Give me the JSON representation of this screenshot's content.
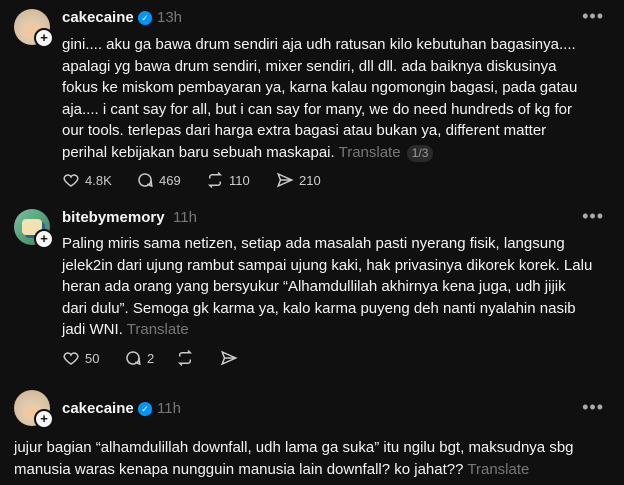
{
  "posts": [
    {
      "username": "cakecaine",
      "verified": true,
      "time": "13h",
      "lines": [
        "gini.... aku ga bawa drum sendiri aja udh ratusan kilo kebutuhan bagasinya....",
        "apalagi yg bawa drum sendiri, mixer sendiri, dll dll. ada baiknya diskusinya",
        "fokus ke miskom pembayaran ya, karna kalau ngomongin bagasi, pada gatau",
        "aja.... i cant say for all, but i can say for many, we do need hundreds of kg for",
        "our tools. terlepas dari harga extra bagasi atau bukan ya, different matter",
        "perihal kebijakan baru sebuah maskapai."
      ],
      "translate": "Translate",
      "pager": "1/3",
      "likes": "4.8K",
      "comments": "469",
      "reposts": "110",
      "shares": "210"
    },
    {
      "username": "bitebymemory",
      "verified": false,
      "time": "11h",
      "lines": [
        "Paling miris sama netizen, setiap ada masalah pasti nyerang fisik, langsung",
        "jelek2in dari ujung rambut sampai ujung kaki, hak privasinya dikorek korek. Lalu",
        "heran ada orang yang bersyukur “Alhamdullilah akhirnya kena juga, udh jijik",
        "dari dulu”. Semoga gk karma ya, kalo karma puyeng deh nanti nyalahin nasib",
        "jadi WNI."
      ],
      "translate": "Translate",
      "likes": "50",
      "comments": "2"
    },
    {
      "username": "cakecaine",
      "verified": true,
      "time": "11h",
      "lines": [
        "jujur bagian “alhamdulillah downfall, udh lama ga suka” itu ngilu bgt, maksudnya sbg",
        "manusia waras kenapa nungguin manusia lain downfall? ko jahat??"
      ],
      "translate": "Translate"
    }
  ],
  "more_icon": "•••",
  "verified_icon": "✓",
  "plus_icon": "+",
  "icons": [
    "heart-icon",
    "comment-icon",
    "repost-icon",
    "share-icon",
    "more-icon",
    "verified-icon",
    "follow-plus-icon"
  ],
  "colors": {
    "background": "#101010",
    "text": "#f3f5f7",
    "muted": "#777777",
    "verified": "#0095f6"
  }
}
